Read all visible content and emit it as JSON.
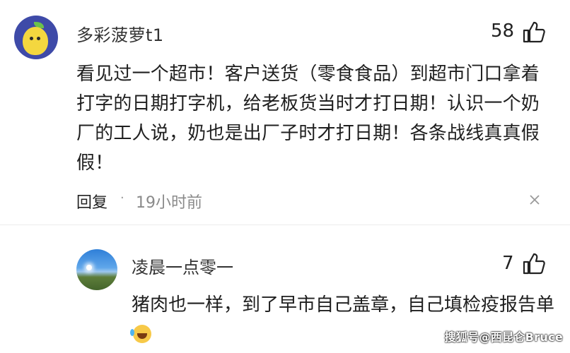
{
  "comment": {
    "username": "多彩菠萝t1",
    "like_count": "58",
    "text": "看见过一个超市！客户送货（零食食品）到超市门口拿着打字的日期打字机，给老板货当时才打日期！认识一个奶厂的工人说，奶也是出厂子时才打日期！各条战线真真假假！",
    "reply_label": "回复",
    "separator": "·",
    "time": "19小时前",
    "more_icon": "close-icon"
  },
  "reply": {
    "username": "凌晨一点零一",
    "like_count": "7",
    "text": "猪肉也一样，到了早市自己盖章，自己填检疫报告单",
    "emoji": "laughing-crying-emoji"
  },
  "watermark": "搜狐号@西昆仑Bruce",
  "colors": {
    "text": "#1f1f1f",
    "muted": "#8a8a8a",
    "avatar_bg": "#3e4aa8"
  }
}
